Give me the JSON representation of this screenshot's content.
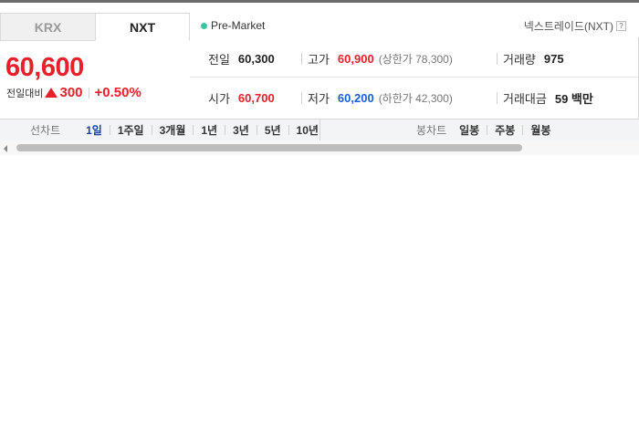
{
  "tabs": [
    {
      "label": "KRX",
      "selected": false
    },
    {
      "label": "NXT",
      "selected": true
    }
  ],
  "status": {
    "label": "Pre-Market",
    "color": "#3cc4a0"
  },
  "exchange": {
    "label": "넥스트레이드(NXT)",
    "help": "?"
  },
  "quote": {
    "price": "60,600",
    "change_label": "전일대비",
    "direction": "up",
    "change": "300",
    "change_pct": "+0.50%"
  },
  "stats": {
    "prev_close": {
      "label": "전일",
      "value": "60,300"
    },
    "high": {
      "label": "고가",
      "value": "60,900",
      "limit_label": "(상한가 78,300)"
    },
    "volume": {
      "label": "거래량",
      "value": "975"
    },
    "open": {
      "label": "시가",
      "value": "60,700"
    },
    "low": {
      "label": "저가",
      "value": "60,200",
      "limit_label": "(하한가 42,300)"
    },
    "amount": {
      "label": "거래대금",
      "value": "59 백만"
    }
  },
  "line_chart": {
    "title": "선차트",
    "periods": [
      "1일",
      "1주일",
      "3개월",
      "1년",
      "3년",
      "5년",
      "10년"
    ],
    "selected": "1일"
  },
  "candle_chart": {
    "title": "봉차트",
    "periods": [
      "일봉",
      "주봉",
      "월봉"
    ]
  },
  "colors": {
    "up": "#e8202a",
    "down": "#1a5fd1",
    "selected": "#1a3fa8"
  }
}
